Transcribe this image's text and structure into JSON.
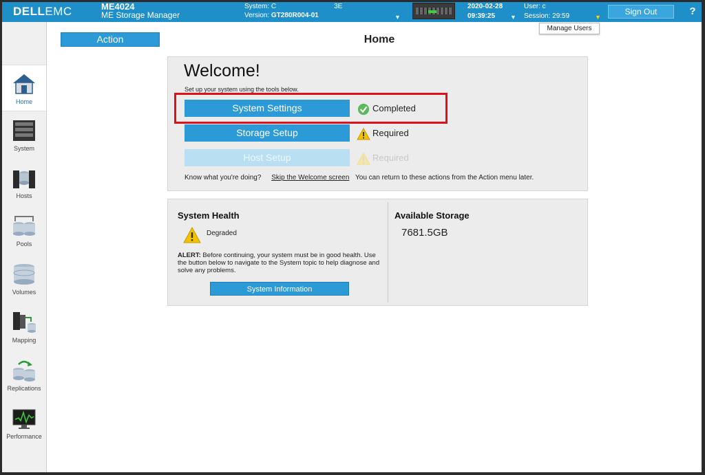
{
  "header": {
    "logo_bold": "DELL",
    "logo_light": "EMC",
    "model": "ME4024",
    "product": "ME Storage Manager",
    "system_label": "System: C",
    "system_suffix": "3E",
    "version_label": "Version:",
    "version_value": "GT280R004-01",
    "date": "2020-02-28",
    "time": "09:39:25",
    "user": "User: c",
    "session": "Session: 29:59",
    "sign_out": "Sign Out",
    "help": "?",
    "manage_users": "Manage Users"
  },
  "sidebar": {
    "items": [
      {
        "label": "Home",
        "icon": "home-icon"
      },
      {
        "label": "System",
        "icon": "system-icon"
      },
      {
        "label": "Hosts",
        "icon": "hosts-icon"
      },
      {
        "label": "Pools",
        "icon": "pools-icon"
      },
      {
        "label": "Volumes",
        "icon": "volumes-icon"
      },
      {
        "label": "Mapping",
        "icon": "mapping-icon"
      },
      {
        "label": "Replications",
        "icon": "replications-icon"
      },
      {
        "label": "Performance",
        "icon": "performance-icon"
      }
    ]
  },
  "main": {
    "action_label": "Action",
    "page_title": "Home",
    "welcome": {
      "title": "Welcome!",
      "subtitle": "Set up your system using the tools below.",
      "steps": [
        {
          "label": "System Settings",
          "status": "Completed"
        },
        {
          "label": "Storage Setup",
          "status": "Required"
        },
        {
          "label": "Host Setup",
          "status": "Required"
        }
      ],
      "footer_prefix": "Know what you're doing?",
      "footer_link": "Skip the Welcome screen",
      "footer_suffix": "You can return to these actions from the Action menu later."
    },
    "health": {
      "title": "System Health",
      "state": "Degraded",
      "alert_label": "ALERT:",
      "alert_text": "Before continuing, your system must be in good health. Use the button below to navigate to the System topic to help diagnose and solve any problems.",
      "button": "System Information"
    },
    "storage": {
      "title": "Available Storage",
      "value": "7681.5GB"
    }
  },
  "colors": {
    "header_blue": "#1f8fc9",
    "button_blue": "#2b9ad6",
    "highlight_red": "#e0101a",
    "success_green": "#5cb85c",
    "warning_yellow": "#f2c200"
  }
}
